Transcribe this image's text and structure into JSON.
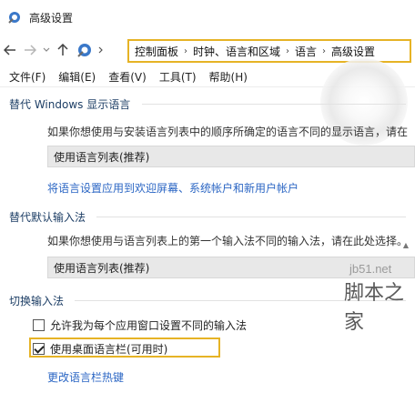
{
  "window": {
    "title": "高级设置"
  },
  "address": {
    "breadcrumbs": [
      "控制面板",
      "时钟、语言和区域",
      "语言",
      "高级设置"
    ]
  },
  "menu": [
    "文件(F)",
    "编辑(E)",
    "查看(V)",
    "工具(T)",
    "帮助(H)"
  ],
  "display_language": {
    "title": "替代 Windows 显示语言",
    "description": "如果你想使用与安装语言列表中的顺序所确定的语言不同的显示语言，请在",
    "select_value": "使用语言列表(推荐)",
    "link": "将语言设置应用到欢迎屏幕、系统帐户和新用户帐户"
  },
  "input_method": {
    "title": "替代默认输入法",
    "description": "如果你想使用与语言列表上的第一个输入法不同的输入法，请在此处选择。",
    "select_value": "使用语言列表(推荐)"
  },
  "switch_input": {
    "title": "切换输入法",
    "option1": {
      "label": "允许我为每个应用窗口设置不同的输入法",
      "checked": false
    },
    "option2": {
      "label": "使用桌面语言栏(可用时)",
      "checked": true
    },
    "link": "更改语言栏热键"
  },
  "watermark": {
    "site": "jb51.net",
    "brand": "脚本之家"
  },
  "colors": {
    "accent_highlight": "#e6b325",
    "link": "#2b66c4",
    "section_title": "#1e3f66"
  }
}
